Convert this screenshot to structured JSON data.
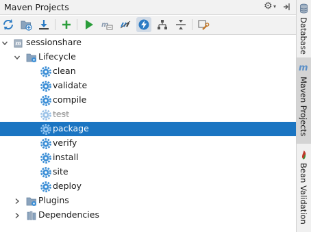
{
  "panel": {
    "title": "Maven Projects",
    "gear_icon": "gear-icon",
    "caret": "▾"
  },
  "toolbar": {
    "buttons": [
      {
        "name": "reimport",
        "icon": "refresh-icon"
      },
      {
        "name": "generate-sources",
        "icon": "folder-add-icon"
      },
      {
        "name": "download",
        "icon": "download-icon"
      },
      {
        "name": "add-project",
        "icon": "plus-icon"
      },
      {
        "name": "run",
        "icon": "play-icon"
      },
      {
        "name": "execute-goal",
        "icon": "maven-goal-icon"
      },
      {
        "name": "toggle-offline",
        "icon": "offline-icon"
      },
      {
        "name": "skip-tests",
        "icon": "lightning-icon",
        "active": true
      },
      {
        "name": "show-dependencies",
        "icon": "diagram-icon"
      },
      {
        "name": "collapse-all",
        "icon": "collapse-icon"
      },
      {
        "name": "settings",
        "icon": "wrench-icon"
      }
    ]
  },
  "tree": {
    "project": "sessionshare",
    "lifecycle_label": "Lifecycle",
    "goals": [
      "clean",
      "validate",
      "compile",
      "test",
      "package",
      "verify",
      "install",
      "site",
      "deploy"
    ],
    "skipped_goal": "test",
    "selected_goal": "package",
    "plugins_label": "Plugins",
    "dependencies_label": "Dependencies"
  },
  "side_tabs": {
    "database": "Database",
    "maven_projects": "Maven Projects",
    "bean_validation": "Bean Validation",
    "maven_m": "m"
  },
  "colors": {
    "selection": "#1b75c2",
    "gear_blue": "#3d8fd6",
    "play_green": "#2a9d3a"
  }
}
